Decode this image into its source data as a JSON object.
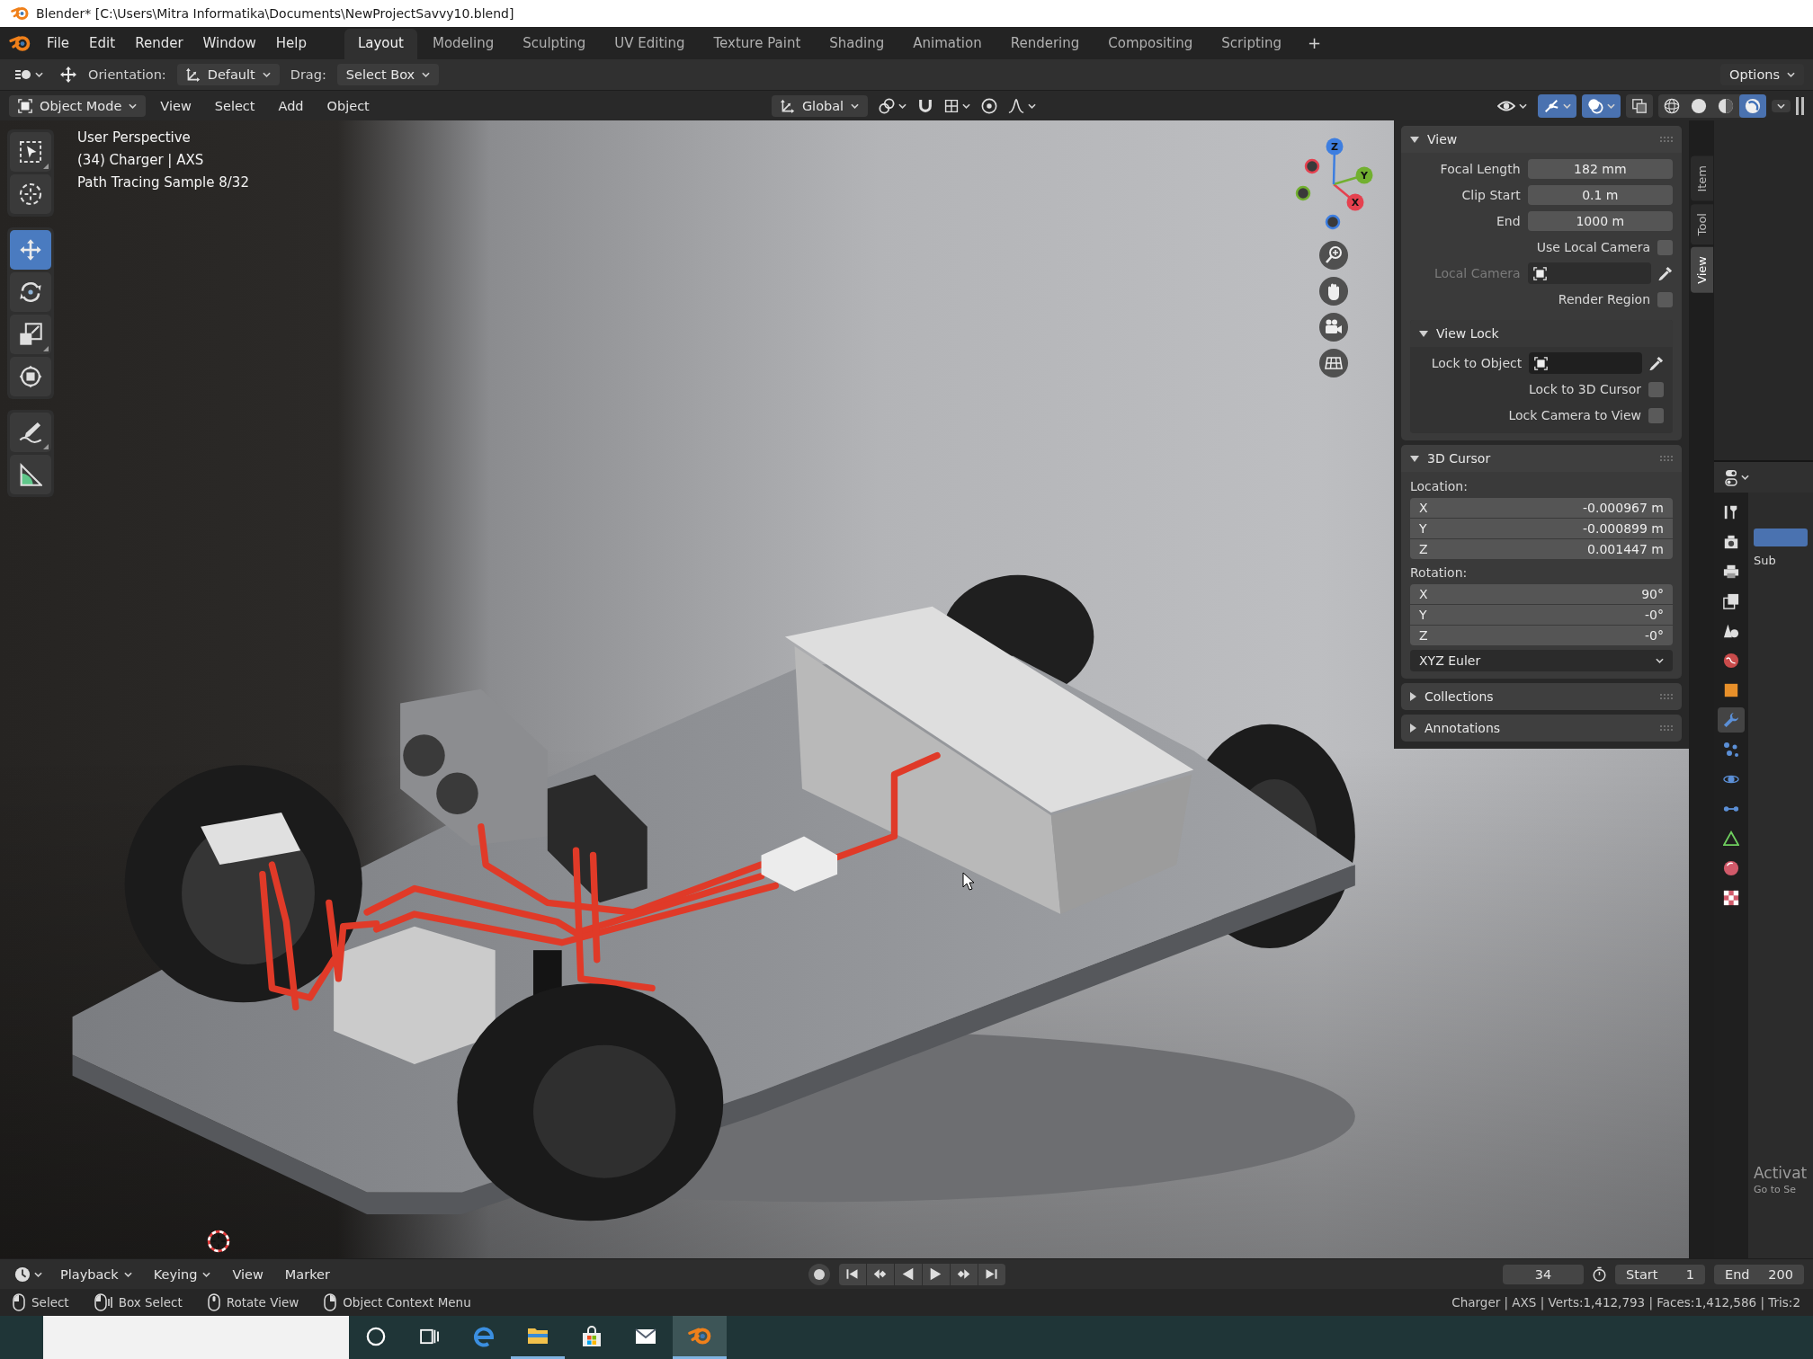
{
  "window": {
    "title": "Blender* [C:\\Users\\Mitra Informatika\\Documents\\NewProjectSavvy10.blend]"
  },
  "menu": [
    "File",
    "Edit",
    "Render",
    "Window",
    "Help"
  ],
  "workspaces": [
    {
      "label": "Layout",
      "selected": true
    },
    {
      "label": "Modeling",
      "selected": false
    },
    {
      "label": "Sculpting",
      "selected": false
    },
    {
      "label": "UV Editing",
      "selected": false
    },
    {
      "label": "Texture Paint",
      "selected": false
    },
    {
      "label": "Shading",
      "selected": false
    },
    {
      "label": "Animation",
      "selected": false
    },
    {
      "label": "Rendering",
      "selected": false
    },
    {
      "label": "Compositing",
      "selected": false
    },
    {
      "label": "Scripting",
      "selected": false
    }
  ],
  "add_workspace": "+",
  "tool_settings": {
    "orientation_label": "Orientation:",
    "orientation": "Default",
    "drag_label": "Drag:",
    "drag": "Select Box",
    "options": "Options"
  },
  "viewport_header": {
    "mode": "Object Mode",
    "menus": [
      "View",
      "Select",
      "Add",
      "Object"
    ],
    "transform_orientation": "Global",
    "toggles": [
      {
        "kind": "gizmos",
        "on": true
      },
      {
        "kind": "overlays",
        "on": true
      },
      {
        "kind": "xray",
        "on": false
      }
    ],
    "shading": [
      {
        "kind": "wireframe",
        "selected": false
      },
      {
        "kind": "solid",
        "selected": false
      },
      {
        "kind": "material",
        "selected": false
      },
      {
        "kind": "rendered",
        "selected": true
      }
    ]
  },
  "toolbar": [
    {
      "tools": [
        {
          "kind": "select_box",
          "selected": false,
          "more": true
        },
        {
          "kind": "cursor",
          "selected": false,
          "more": false
        }
      ]
    },
    {
      "tools": [
        {
          "kind": "move",
          "selected": true,
          "more": false
        },
        {
          "kind": "rotate",
          "selected": false,
          "more": false
        },
        {
          "kind": "scale",
          "selected": false,
          "more": true
        },
        {
          "kind": "transform",
          "selected": false,
          "more": false
        }
      ]
    },
    {
      "tools": [
        {
          "kind": "annotate",
          "selected": false,
          "more": true
        },
        {
          "kind": "measure",
          "selected": false,
          "more": false
        }
      ]
    }
  ],
  "viewport": {
    "info": [
      "User Perspective",
      "(34) Charger | AXS",
      "Path Tracing Sample 8/32"
    ],
    "nav_gizmo": {
      "axes": [
        {
          "label": "X",
          "color": "#e5414f"
        },
        {
          "label": "Y",
          "color": "#72b030"
        },
        {
          "label": "Z",
          "color": "#3d7ee0"
        }
      ]
    }
  },
  "sidebar": {
    "tabs": [
      {
        "label": "Item",
        "selected": false
      },
      {
        "label": "Tool",
        "selected": false
      },
      {
        "label": "View",
        "selected": true
      }
    ],
    "panels": [
      {
        "title": "View",
        "expanded": true,
        "rows": [
          {
            "kind": "number",
            "label": "Focal Length",
            "value": "182 mm",
            "disabled": false
          },
          {
            "kind": "number",
            "label": "Clip Start",
            "value": "0.1 m",
            "disabled": false
          },
          {
            "kind": "number",
            "label": "End",
            "value": "1000 m",
            "disabled": false
          },
          {
            "kind": "checkbox",
            "label": "Use Local Camera",
            "checked": false,
            "disabled": false
          },
          {
            "kind": "object",
            "label": "Local Camera",
            "disabled": true
          },
          {
            "kind": "checkbox",
            "label": "Render Region",
            "checked": false,
            "disabled": false
          }
        ],
        "children": [
          {
            "title": "View Lock",
            "expanded": true,
            "rows": [
              {
                "kind": "object",
                "label": "Lock to Object",
                "disabled": false
              },
              {
                "kind": "checkbox",
                "label": "Lock to 3D Cursor",
                "checked": false,
                "disabled": false
              },
              {
                "kind": "checkbox",
                "label": "Lock Camera to View",
                "checked": false,
                "disabled": false
              }
            ]
          }
        ]
      },
      {
        "title": "3D Cursor",
        "expanded": true,
        "rows": [
          {
            "kind": "heading",
            "label": "Location:"
          },
          {
            "kind": "vector",
            "items": [
              {
                "axis": "X",
                "value": "-0.000967 m"
              },
              {
                "axis": "Y",
                "value": "-0.000899 m"
              },
              {
                "axis": "Z",
                "value": "0.001447 m"
              }
            ]
          },
          {
            "kind": "heading",
            "label": "Rotation:"
          },
          {
            "kind": "vector",
            "items": [
              {
                "axis": "X",
                "value": "90°"
              },
              {
                "axis": "Y",
                "value": "-0°"
              },
              {
                "axis": "Z",
                "value": "-0°"
              }
            ]
          },
          {
            "kind": "dropdown",
            "value": "XYZ Euler"
          }
        ]
      },
      {
        "title": "Collections",
        "expanded": false
      },
      {
        "title": "Annotations",
        "expanded": false
      }
    ]
  },
  "properties": {
    "tabs": [
      {
        "kind": "tool",
        "selected": false
      },
      {
        "kind": "render",
        "selected": false
      },
      {
        "kind": "output",
        "selected": false
      },
      {
        "kind": "view_layer",
        "selected": false
      },
      {
        "kind": "scene",
        "selected": false
      },
      {
        "kind": "world",
        "selected": false
      },
      {
        "kind": "object",
        "selected": false
      },
      {
        "kind": "modifiers",
        "selected": true
      },
      {
        "kind": "particles",
        "selected": false
      },
      {
        "kind": "physics",
        "selected": false
      },
      {
        "kind": "constraints",
        "selected": false
      },
      {
        "kind": "data",
        "selected": false
      },
      {
        "kind": "material",
        "selected": false
      },
      {
        "kind": "texture",
        "selected": false
      }
    ],
    "label": "Sub"
  },
  "timeline": {
    "menus": [
      {
        "label": "Playback",
        "dropdown": true
      },
      {
        "label": "Keying",
        "dropdown": true
      },
      {
        "label": "View",
        "dropdown": false
      },
      {
        "label": "Marker",
        "dropdown": false
      }
    ],
    "auto_keying": false,
    "current_frame": "34",
    "start_label": "Start",
    "start": "1",
    "end_label": "End",
    "end": "200"
  },
  "status_bar": {
    "hints": [
      {
        "kind": "left_click",
        "label": "Select"
      },
      {
        "kind": "left_drag",
        "label": "Box Select"
      },
      {
        "kind": "middle_drag",
        "label": "Rotate View"
      },
      {
        "kind": "right_click",
        "label": "Object Context Menu"
      }
    ],
    "stats": "Charger | AXS | Verts:1,412,793 | Faces:1,412,586 | Tris:2"
  },
  "taskbar": {
    "items": [
      {
        "kind": "search",
        "selected": false,
        "running": false
      },
      {
        "kind": "task_view",
        "selected": false,
        "running": false
      },
      {
        "kind": "edge",
        "selected": false,
        "running": false
      },
      {
        "kind": "explorer",
        "selected": false,
        "running": true
      },
      {
        "kind": "store",
        "selected": false,
        "running": false
      },
      {
        "kind": "mail",
        "selected": false,
        "running": false
      },
      {
        "kind": "blender",
        "selected": true,
        "running": true
      }
    ]
  },
  "activation_notice": {
    "title": "Activat",
    "text": "Go to Se"
  }
}
